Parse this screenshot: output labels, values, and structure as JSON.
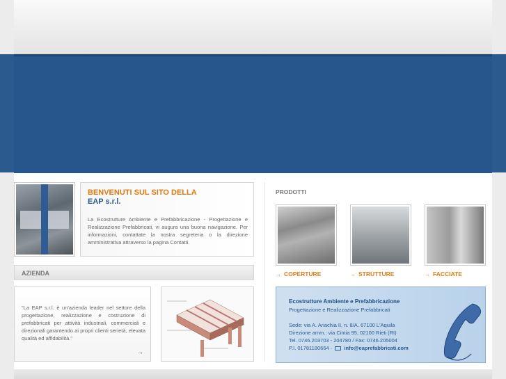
{
  "welcome": {
    "title_line1": "BENVENUTI SUL SITO DELLA",
    "title_line2": "EAP s.r.l.",
    "body": "La Ecostrutture Ambiente e Prefabbricazione - Progettazione e Realizzazione Prefabbricati, vi augura una buona navigazione. Per informazioni, contattate la nostra segreteria o la direzione amministrativa attraverso la pagina Contatti."
  },
  "azienda": {
    "heading": "AZIENDA",
    "quote": "\"La EAP s.r.l. è un'azienda leader nel settore della progettazione, realizzazione e costruzione di prefabbricati per attività industriali, commerciali e direzionali garantendo ai propri clienti serietà, elevata qualità ed affidabilità.\"",
    "more_arrow": "→"
  },
  "prodotti": {
    "heading": "PRODOTTI",
    "items": [
      {
        "label": "COPERTURE"
      },
      {
        "label": "STRUTTURE"
      },
      {
        "label": "FACCIATE"
      }
    ],
    "bullet": "→"
  },
  "contact": {
    "company": "Ecostrutture Ambiente e Prefabbricazione",
    "tagline": "Progettazione e Realizzazione Prefabbricati",
    "sede": "Sede: via A. Ariachia II, n. 8/A. 67100 L'Aquila",
    "direzione": "Direzione amm.: via Cintia 95, 02100 Rieti (RI)",
    "tel": "Tel. 0746.203703 - 204780 / Fax: 0746.205004",
    "piva": "P.I. 01781180664 ·",
    "email": "info@eaprefabbricati.com"
  },
  "colors": {
    "banner": "#26568b",
    "accent_orange": "#e07b10",
    "brand_blue": "#2d5a8c"
  }
}
